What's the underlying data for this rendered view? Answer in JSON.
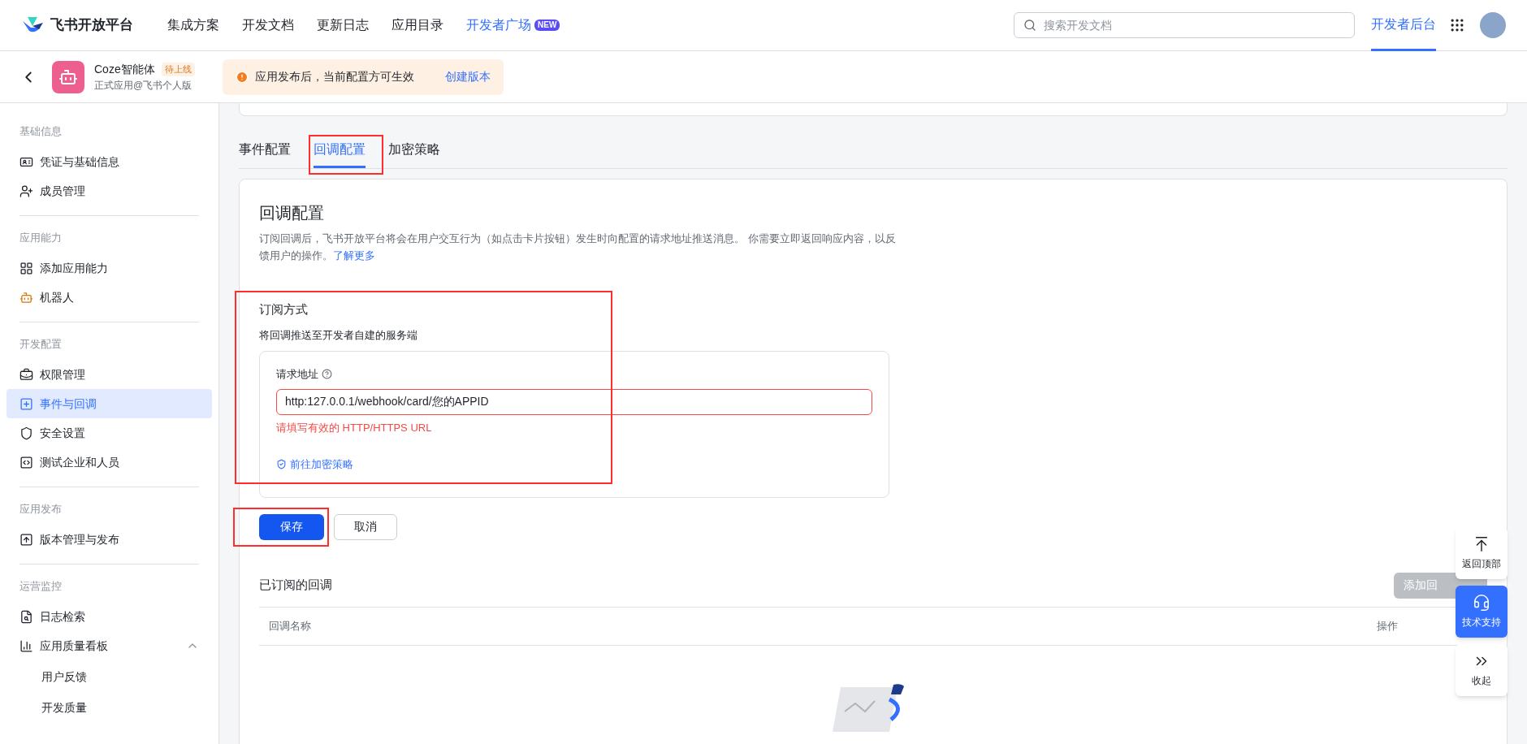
{
  "topbar": {
    "brand": "飞书开放平台",
    "nav": [
      {
        "label": "集成方案"
      },
      {
        "label": "开发文档"
      },
      {
        "label": "更新日志"
      },
      {
        "label": "应用目录"
      },
      {
        "label": "开发者广场",
        "badge": "NEW"
      }
    ],
    "search": {
      "placeholder": "搜索开发文档"
    },
    "console": {
      "label": "开发者后台",
      "selected": true
    }
  },
  "app_header": {
    "name": "Coze智能体",
    "status": "待上线",
    "subtitle": "正式应用@飞书个人版",
    "notice": "应用发布后，当前配置方可生效",
    "notice_action": "创建版本"
  },
  "sidebar": [
    {
      "title": "基础信息",
      "items": [
        {
          "label": "凭证与基础信息",
          "selected": false
        },
        {
          "label": "成员管理",
          "selected": false
        }
      ]
    },
    {
      "title": "应用能力",
      "items": [
        {
          "label": "添加应用能力",
          "selected": false
        },
        {
          "label": "机器人",
          "selected": false
        }
      ]
    },
    {
      "title": "开发配置",
      "items": [
        {
          "label": "权限管理",
          "selected": false
        },
        {
          "label": "事件与回调",
          "selected": true
        },
        {
          "label": "安全设置",
          "selected": false
        },
        {
          "label": "测试企业和人员",
          "selected": false
        }
      ]
    },
    {
      "title": "应用发布",
      "items": [
        {
          "label": "版本管理与发布",
          "selected": false
        }
      ]
    },
    {
      "title": "运营监控",
      "items": [
        {
          "label": "日志检索",
          "selected": false
        },
        {
          "label": "应用质量看板",
          "selected": false,
          "expanded": true,
          "children": [
            {
              "label": "用户反馈",
              "selected": false
            },
            {
              "label": "开发质量",
              "selected": false
            }
          ]
        }
      ]
    }
  ],
  "tabs": [
    {
      "label": "事件配置",
      "selected": false,
      "highlighted": false
    },
    {
      "label": "回调配置",
      "selected": true,
      "highlighted": true
    },
    {
      "label": "加密策略",
      "selected": false,
      "highlighted": false
    }
  ],
  "callback": {
    "title": "回调配置",
    "description": "订阅回调后，飞书开放平台将会在用户交互行为（如点击卡片按钮）发生时向配置的请求地址推送消息。 你需要立即返回响应内容，以反馈用户的操作。",
    "learn_more": "了解更多",
    "subscription": {
      "title": "订阅方式",
      "subtitle": "将回调推送至开发者自建的服务端",
      "highlighted": true,
      "field_label": "请求地址",
      "value": "http:127.0.0.1/webhook/card/您的APPID",
      "error": "请填写有效的 HTTP/HTTPS URL",
      "link": "前往加密策略"
    },
    "buttons": [
      {
        "label": "保存",
        "kind": "primary",
        "highlighted": true
      },
      {
        "label": "取消",
        "kind": "secondary",
        "highlighted": false
      }
    ],
    "subscribed": {
      "title": "已订阅的回调",
      "add": "添加回",
      "add_disabled": true,
      "columns": [
        "回调名称",
        "操作"
      ]
    }
  },
  "float_buttons": [
    {
      "label": "返回顶部",
      "selected": false
    },
    {
      "label": "技术支持",
      "selected": true
    },
    {
      "label": "收起",
      "selected": false
    }
  ]
}
